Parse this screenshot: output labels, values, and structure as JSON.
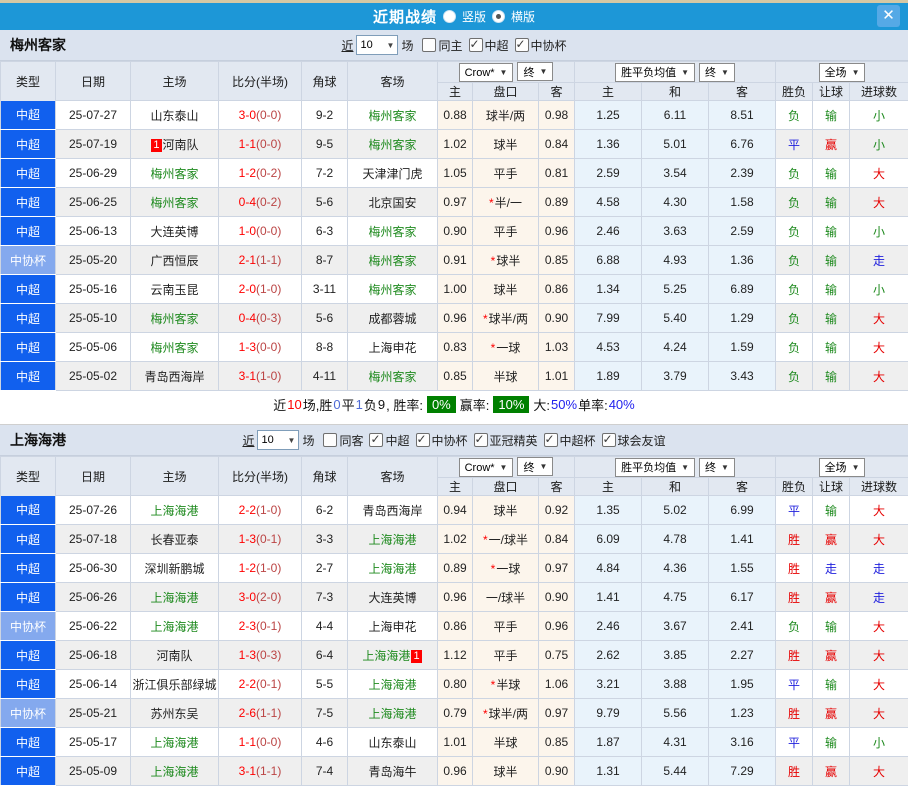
{
  "titlebar": {
    "title": "近期战绩",
    "radios": [
      {
        "label": "竖版",
        "selected": false
      },
      {
        "label": "横版",
        "selected": true
      }
    ],
    "close_glyph": "✕"
  },
  "controls": {
    "near_label": "近",
    "games_label": "场",
    "dropdown_arrow": "▼"
  },
  "header": {
    "cols": [
      "类型",
      "日期",
      "主场",
      "比分(半场)",
      "角球",
      "客场"
    ],
    "asian_sub": [
      "主",
      "盘口",
      "客"
    ],
    "euro_sub": [
      "主",
      "和",
      "客"
    ],
    "result_sub": [
      "胜负",
      "让球",
      "进球数"
    ],
    "dropdowns": {
      "bookmaker": "Crow*",
      "asian_final": "终",
      "euro_avg": "胜平负均值",
      "euro_final": "终",
      "scope": "全场"
    }
  },
  "colors": {
    "title_bar": "#1d97d7",
    "type_map": {
      "中超": "#1160ee",
      "中协杯": "#84a9ee"
    },
    "team_green": "#1e8a1e",
    "score_red": "#ff0000",
    "half_red": "#bb4444",
    "result_map": {
      "胜": "#e60000",
      "平": "#2020dd",
      "负": "#1e8a1e",
      "赢": "#e60000",
      "输": "#1e8a1e",
      "走": "#2020dd",
      "大": "#e60000",
      "小": "#1e8a1e"
    },
    "rate_badge_bg": "#008000"
  },
  "sections": [
    {
      "team": "梅州客家",
      "filters": {
        "count": "10",
        "checkboxes": [
          {
            "label": "同主",
            "checked": false
          },
          {
            "label": "中超",
            "checked": true
          },
          {
            "label": "中协杯",
            "checked": true
          }
        ]
      },
      "rows": [
        {
          "type": "中超",
          "date": "25-07-27",
          "home": "山东泰山",
          "home_green": false,
          "home_mark": "",
          "score": "3-0",
          "half": "(0-0)",
          "corner": "9-2",
          "away": "梅州客家",
          "away_green": true,
          "away_mark": "",
          "ah": "0.88",
          "hc": "球半/两",
          "hc_star": false,
          "aa": "0.98",
          "eh": "1.25",
          "ed": "6.11",
          "ea": "8.51",
          "wl": "负",
          "rq": "输",
          "dx": "小"
        },
        {
          "type": "中超",
          "date": "25-07-19",
          "home": "河南队",
          "home_green": false,
          "home_mark": "1",
          "score": "1-1",
          "half": "(0-0)",
          "corner": "9-5",
          "away": "梅州客家",
          "away_green": true,
          "away_mark": "",
          "ah": "1.02",
          "hc": "球半",
          "hc_star": false,
          "aa": "0.84",
          "eh": "1.36",
          "ed": "5.01",
          "ea": "6.76",
          "wl": "平",
          "rq": "赢",
          "dx": "小"
        },
        {
          "type": "中超",
          "date": "25-06-29",
          "home": "梅州客家",
          "home_green": true,
          "home_mark": "",
          "score": "1-2",
          "half": "(0-2)",
          "corner": "7-2",
          "away": "天津津门虎",
          "away_green": false,
          "away_mark": "",
          "ah": "1.05",
          "hc": "平手",
          "hc_star": false,
          "aa": "0.81",
          "eh": "2.59",
          "ed": "3.54",
          "ea": "2.39",
          "wl": "负",
          "rq": "输",
          "dx": "大"
        },
        {
          "type": "中超",
          "date": "25-06-25",
          "home": "梅州客家",
          "home_green": true,
          "home_mark": "",
          "score": "0-4",
          "half": "(0-2)",
          "corner": "5-6",
          "away": "北京国安",
          "away_green": false,
          "away_mark": "",
          "ah": "0.97",
          "hc": "半/一",
          "hc_star": true,
          "aa": "0.89",
          "eh": "4.58",
          "ed": "4.30",
          "ea": "1.58",
          "wl": "负",
          "rq": "输",
          "dx": "大"
        },
        {
          "type": "中超",
          "date": "25-06-13",
          "home": "大连英博",
          "home_green": false,
          "home_mark": "",
          "score": "1-0",
          "half": "(0-0)",
          "corner": "6-3",
          "away": "梅州客家",
          "away_green": true,
          "away_mark": "",
          "ah": "0.90",
          "hc": "平手",
          "hc_star": false,
          "aa": "0.96",
          "eh": "2.46",
          "ed": "3.63",
          "ea": "2.59",
          "wl": "负",
          "rq": "输",
          "dx": "小"
        },
        {
          "type": "中协杯",
          "date": "25-05-20",
          "home": "广西恒辰",
          "home_green": false,
          "home_mark": "",
          "score": "2-1",
          "half": "(1-1)",
          "corner": "8-7",
          "away": "梅州客家",
          "away_green": true,
          "away_mark": "",
          "ah": "0.91",
          "hc": "球半",
          "hc_star": true,
          "aa": "0.85",
          "eh": "6.88",
          "ed": "4.93",
          "ea": "1.36",
          "wl": "负",
          "rq": "输",
          "dx": "走"
        },
        {
          "type": "中超",
          "date": "25-05-16",
          "home": "云南玉昆",
          "home_green": false,
          "home_mark": "",
          "score": "2-0",
          "half": "(1-0)",
          "corner": "3-11",
          "away": "梅州客家",
          "away_green": true,
          "away_mark": "",
          "ah": "1.00",
          "hc": "球半",
          "hc_star": false,
          "aa": "0.86",
          "eh": "1.34",
          "ed": "5.25",
          "ea": "6.89",
          "wl": "负",
          "rq": "输",
          "dx": "小"
        },
        {
          "type": "中超",
          "date": "25-05-10",
          "home": "梅州客家",
          "home_green": true,
          "home_mark": "",
          "score": "0-4",
          "half": "(0-3)",
          "corner": "5-6",
          "away": "成都蓉城",
          "away_green": false,
          "away_mark": "",
          "ah": "0.96",
          "hc": "球半/两",
          "hc_star": true,
          "aa": "0.90",
          "eh": "7.99",
          "ed": "5.40",
          "ea": "1.29",
          "wl": "负",
          "rq": "输",
          "dx": "大"
        },
        {
          "type": "中超",
          "date": "25-05-06",
          "home": "梅州客家",
          "home_green": true,
          "home_mark": "",
          "score": "1-3",
          "half": "(0-0)",
          "corner": "8-8",
          "away": "上海申花",
          "away_green": false,
          "away_mark": "",
          "ah": "0.83",
          "hc": "一球",
          "hc_star": true,
          "aa": "1.03",
          "eh": "4.53",
          "ed": "4.24",
          "ea": "1.59",
          "wl": "负",
          "rq": "输",
          "dx": "大"
        },
        {
          "type": "中超",
          "date": "25-05-02",
          "home": "青岛西海岸",
          "home_green": false,
          "home_mark": "",
          "score": "3-1",
          "half": "(1-0)",
          "corner": "4-11",
          "away": "梅州客家",
          "away_green": true,
          "away_mark": "",
          "ah": "0.85",
          "hc": "半球",
          "hc_star": false,
          "aa": "1.01",
          "eh": "1.89",
          "ed": "3.79",
          "ea": "3.43",
          "wl": "负",
          "rq": "输",
          "dx": "大"
        }
      ],
      "summary": {
        "parts": [
          {
            "text": "近",
            "style": "plain"
          },
          {
            "text": "10",
            "style": "red"
          },
          {
            "text": "场,胜",
            "style": "plain"
          },
          {
            "text": "0",
            "style": "blue"
          },
          {
            "text": "平",
            "style": "plain"
          },
          {
            "text": "1",
            "style": "blue"
          },
          {
            "text": "负",
            "style": "plain"
          },
          {
            "text": "9",
            "style": "plain"
          },
          {
            "text": ", 胜率:",
            "style": "plain"
          },
          {
            "text": "0%",
            "style": "badge"
          },
          {
            "text": "赢率:",
            "style": "plain"
          },
          {
            "text": "10%",
            "style": "badge"
          },
          {
            "text": "大:",
            "style": "plain"
          },
          {
            "text": "50%",
            "style": "blue2"
          },
          {
            "text": " 单率:",
            "style": "plain"
          },
          {
            "text": "40%",
            "style": "blue2"
          }
        ]
      }
    },
    {
      "team": "上海海港",
      "filters": {
        "count": "10",
        "checkboxes": [
          {
            "label": "同客",
            "checked": false
          },
          {
            "label": "中超",
            "checked": true
          },
          {
            "label": "中协杯",
            "checked": true
          },
          {
            "label": "亚冠精英",
            "checked": true
          },
          {
            "label": "中超杯",
            "checked": true
          },
          {
            "label": "球会友谊",
            "checked": true
          }
        ]
      },
      "rows": [
        {
          "type": "中超",
          "date": "25-07-26",
          "home": "上海海港",
          "home_green": true,
          "home_mark": "",
          "score": "2-2",
          "half": "(1-0)",
          "corner": "6-2",
          "away": "青岛西海岸",
          "away_green": false,
          "away_mark": "",
          "ah": "0.94",
          "hc": "球半",
          "hc_star": false,
          "aa": "0.92",
          "eh": "1.35",
          "ed": "5.02",
          "ea": "6.99",
          "wl": "平",
          "rq": "输",
          "dx": "大"
        },
        {
          "type": "中超",
          "date": "25-07-18",
          "home": "长春亚泰",
          "home_green": false,
          "home_mark": "",
          "score": "1-3",
          "half": "(0-1)",
          "corner": "3-3",
          "away": "上海海港",
          "away_green": true,
          "away_mark": "",
          "ah": "1.02",
          "hc": "一/球半",
          "hc_star": true,
          "aa": "0.84",
          "eh": "6.09",
          "ed": "4.78",
          "ea": "1.41",
          "wl": "胜",
          "rq": "赢",
          "dx": "大"
        },
        {
          "type": "中超",
          "date": "25-06-30",
          "home": "深圳新鹏城",
          "home_green": false,
          "home_mark": "",
          "score": "1-2",
          "half": "(1-0)",
          "corner": "2-7",
          "away": "上海海港",
          "away_green": true,
          "away_mark": "",
          "ah": "0.89",
          "hc": "一球",
          "hc_star": true,
          "aa": "0.97",
          "eh": "4.84",
          "ed": "4.36",
          "ea": "1.55",
          "wl": "胜",
          "rq": "走",
          "dx": "走"
        },
        {
          "type": "中超",
          "date": "25-06-26",
          "home": "上海海港",
          "home_green": true,
          "home_mark": "",
          "score": "3-0",
          "half": "(2-0)",
          "corner": "7-3",
          "away": "大连英博",
          "away_green": false,
          "away_mark": "",
          "ah": "0.96",
          "hc": "一/球半",
          "hc_star": false,
          "aa": "0.90",
          "eh": "1.41",
          "ed": "4.75",
          "ea": "6.17",
          "wl": "胜",
          "rq": "赢",
          "dx": "走"
        },
        {
          "type": "中协杯",
          "date": "25-06-22",
          "home": "上海海港",
          "home_green": true,
          "home_mark": "",
          "score": "2-3",
          "half": "(0-1)",
          "corner": "4-4",
          "away": "上海申花",
          "away_green": false,
          "away_mark": "",
          "ah": "0.86",
          "hc": "平手",
          "hc_star": false,
          "aa": "0.96",
          "eh": "2.46",
          "ed": "3.67",
          "ea": "2.41",
          "wl": "负",
          "rq": "输",
          "dx": "大"
        },
        {
          "type": "中超",
          "date": "25-06-18",
          "home": "河南队",
          "home_green": false,
          "home_mark": "",
          "score": "1-3",
          "half": "(0-3)",
          "corner": "6-4",
          "away": "上海海港",
          "away_green": true,
          "away_mark": "1",
          "ah": "1.12",
          "hc": "平手",
          "hc_star": false,
          "aa": "0.75",
          "eh": "2.62",
          "ed": "3.85",
          "ea": "2.27",
          "wl": "胜",
          "rq": "赢",
          "dx": "大"
        },
        {
          "type": "中超",
          "date": "25-06-14",
          "home": "浙江俱乐部绿城",
          "home_green": false,
          "home_mark": "",
          "score": "2-2",
          "half": "(0-1)",
          "corner": "5-5",
          "away": "上海海港",
          "away_green": true,
          "away_mark": "",
          "ah": "0.80",
          "hc": "半球",
          "hc_star": true,
          "aa": "1.06",
          "eh": "3.21",
          "ed": "3.88",
          "ea": "1.95",
          "wl": "平",
          "rq": "输",
          "dx": "大"
        },
        {
          "type": "中协杯",
          "date": "25-05-21",
          "home": "苏州东吴",
          "home_green": false,
          "home_mark": "",
          "score": "2-6",
          "half": "(1-1)",
          "corner": "7-5",
          "away": "上海海港",
          "away_green": true,
          "away_mark": "",
          "ah": "0.79",
          "hc": "球半/两",
          "hc_star": true,
          "aa": "0.97",
          "eh": "9.79",
          "ed": "5.56",
          "ea": "1.23",
          "wl": "胜",
          "rq": "赢",
          "dx": "大"
        },
        {
          "type": "中超",
          "date": "25-05-17",
          "home": "上海海港",
          "home_green": true,
          "home_mark": "",
          "score": "1-1",
          "half": "(0-0)",
          "corner": "4-6",
          "away": "山东泰山",
          "away_green": false,
          "away_mark": "",
          "ah": "1.01",
          "hc": "半球",
          "hc_star": false,
          "aa": "0.85",
          "eh": "1.87",
          "ed": "4.31",
          "ea": "3.16",
          "wl": "平",
          "rq": "输",
          "dx": "小"
        },
        {
          "type": "中超",
          "date": "25-05-09",
          "home": "上海海港",
          "home_green": true,
          "home_mark": "",
          "score": "3-1",
          "half": "(1-1)",
          "corner": "7-4",
          "away": "青岛海牛",
          "away_green": false,
          "away_mark": "",
          "ah": "0.96",
          "hc": "球半",
          "hc_star": false,
          "aa": "0.90",
          "eh": "1.31",
          "ed": "5.44",
          "ea": "7.29",
          "wl": "胜",
          "rq": "赢",
          "dx": "大"
        }
      ]
    }
  ]
}
